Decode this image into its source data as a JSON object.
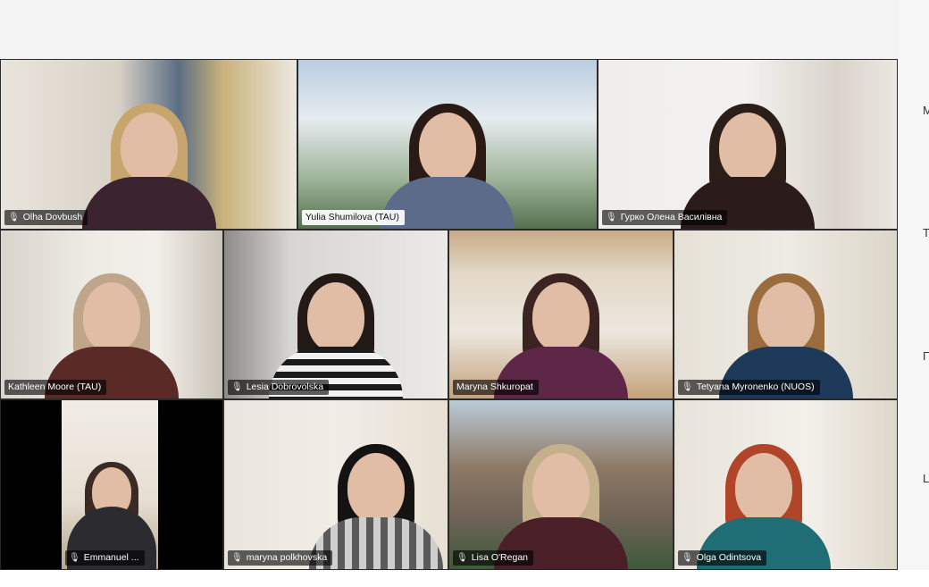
{
  "participants": [
    {
      "name": "Olha Dovbush"
    },
    {
      "name": "Yulia Shumilova (TAU)"
    },
    {
      "name": "Гурко Олена Василівна"
    },
    {
      "name": "Kathleen Moore (TAU)"
    },
    {
      "name": "Lesia Dobrovolska"
    },
    {
      "name": "Maryna Shkuropat"
    },
    {
      "name": "Tetyana Myronenko (NUOS)"
    },
    {
      "name": "Emmanuel ..."
    },
    {
      "name": "maryna polkhovska"
    },
    {
      "name": "Lisa O'Regan"
    },
    {
      "name": "Olga Odintsova"
    }
  ],
  "side_panel": {
    "items": [
      {
        "label": "M"
      },
      {
        "label": "T"
      },
      {
        "label": "П"
      },
      {
        "label": "L"
      }
    ]
  },
  "icons": {
    "mic_muted": "microphone-muted-icon"
  }
}
